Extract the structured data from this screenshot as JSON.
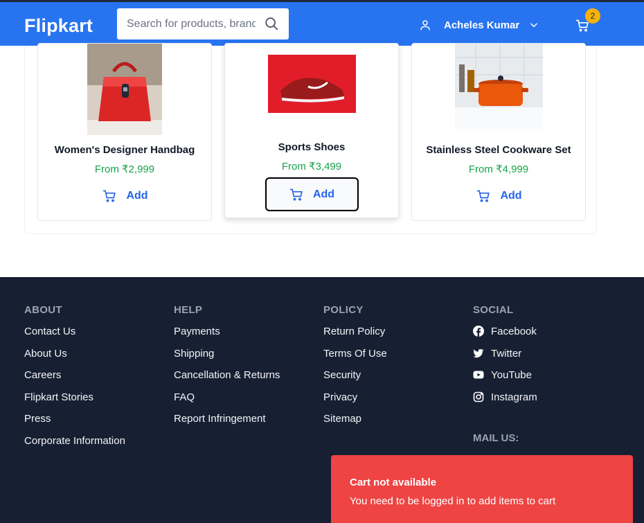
{
  "header": {
    "logo": "Flipkart",
    "search_placeholder": "Search for products, brands and more",
    "user_name": "Acheles Kumar",
    "cart_count": "2"
  },
  "products": [
    {
      "name": "Women's Designer Handbag",
      "price": "From ₹2,999",
      "add_label": "Add"
    },
    {
      "name": "Sports Shoes",
      "price": "From ₹3,499",
      "add_label": "Add"
    },
    {
      "name": "Stainless Steel Cookware Set",
      "price": "From ₹4,999",
      "add_label": "Add"
    }
  ],
  "footer": {
    "about": {
      "heading": "ABOUT",
      "links": [
        "Contact Us",
        "About Us",
        "Careers",
        "Flipkart Stories",
        "Press",
        "Corporate Information"
      ]
    },
    "help": {
      "heading": "HELP",
      "links": [
        "Payments",
        "Shipping",
        "Cancellation & Returns",
        "FAQ",
        "Report Infringement"
      ]
    },
    "policy": {
      "heading": "POLICY",
      "links": [
        "Return Policy",
        "Terms Of Use",
        "Security",
        "Privacy",
        "Sitemap"
      ]
    },
    "social": {
      "heading": "SOCIAL",
      "links": [
        "Facebook",
        "Twitter",
        "YouTube",
        "Instagram"
      ]
    },
    "mail_heading": "MAIL US:"
  },
  "toast": {
    "title": "Cart not available",
    "message": "You need to be logged in to add items to cart"
  },
  "colors": {
    "brand": "#2874f0",
    "footer_bg": "#172033",
    "price": "#16a34a",
    "toast": "#ef4444",
    "badge": "#f5b20a"
  }
}
